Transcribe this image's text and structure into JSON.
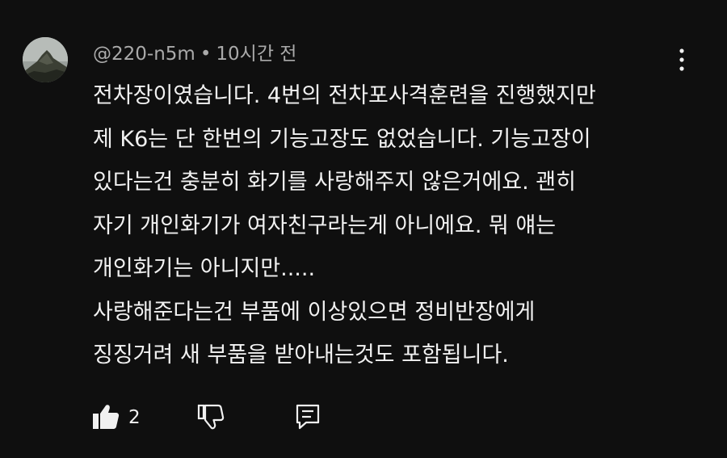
{
  "comment": {
    "author": "@220-n5m",
    "separator": "•",
    "timestamp": "10시간 전",
    "lines": [
      "전차장이였습니다. 4번의 전차포사격훈련을 진행했지만",
      "제 K6는 단 한번의 기능고장도 없었습니다. 기능고장이",
      "있다는건 충분히 화기를 사랑해주지 않은거에요. 괜히",
      "자기 개인화기가 여자친구라는게 아니에요. 뭐 얘는",
      "개인화기는 아니지만.....",
      "사랑해준다는건 부품에 이상있으면 정비반장에게",
      "징징거려 새 부품을 받아내는것도 포함됩니다."
    ],
    "like_count": "2"
  },
  "icons": {
    "avatar": "mountain-avatar",
    "more": "more-vertical-icon",
    "like": "thumbs-up-filled-icon",
    "dislike": "thumbs-down-outline-icon",
    "reply": "reply-comment-icon"
  },
  "colors": {
    "background": "#0f0f0f",
    "text": "#f1f1f1",
    "secondary_text": "#aaaaaa"
  }
}
